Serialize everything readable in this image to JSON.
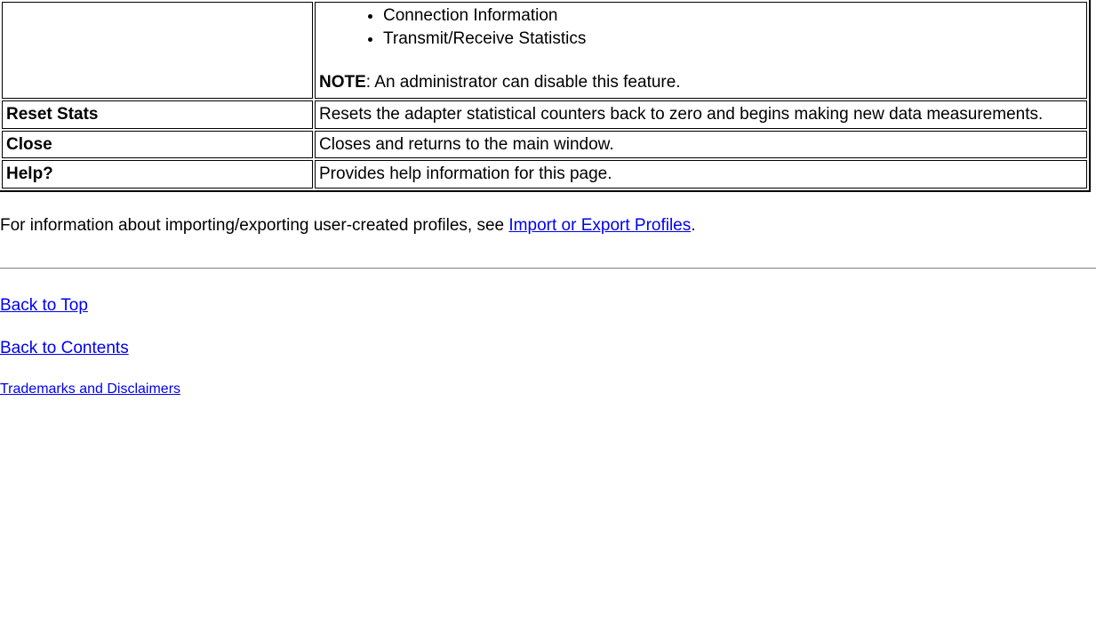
{
  "table": {
    "rows": [
      {
        "left": "",
        "right": {
          "bullets": [
            "Connection Information",
            "Transmit/Receive Statistics"
          ],
          "note_label": "NOTE",
          "note_text": ": An administrator can disable this feature."
        }
      },
      {
        "left": "Reset Stats",
        "right_text": "Resets the adapter statistical counters back to zero and begins making new data measurements."
      },
      {
        "left": "Close",
        "right_text": "Closes and returns to the main window."
      },
      {
        "left": "Help?",
        "right_text": "Provides help information for this page."
      }
    ]
  },
  "paragraph": {
    "pre": "For information about importing/exporting user-created profiles, see ",
    "link": "Import or Export Profiles",
    "post": "."
  },
  "nav": {
    "back_to_top": "Back to Top",
    "back_to_contents": "Back to Contents",
    "trademarks": "Trademarks and Disclaimers"
  }
}
